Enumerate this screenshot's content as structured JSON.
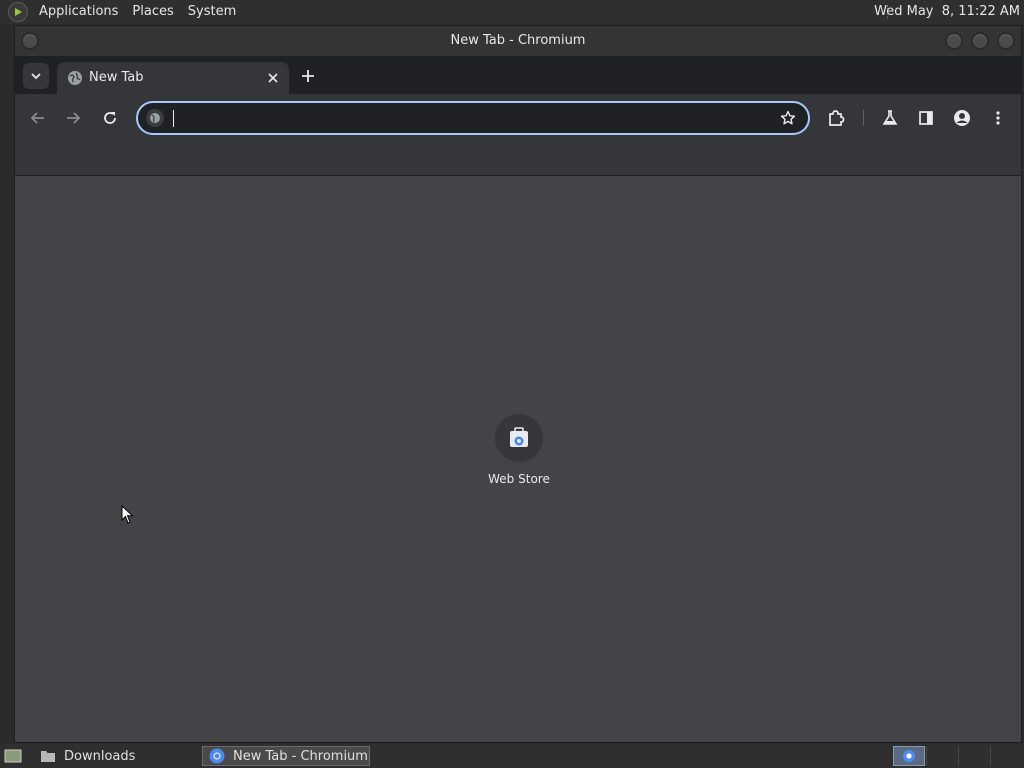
{
  "top_panel": {
    "menus": [
      "Applications",
      "Places",
      "System"
    ],
    "clock": "Wed May  8, 11:22 AM"
  },
  "window": {
    "title": "New Tab - Chromium"
  },
  "tabs": [
    {
      "title": "New Tab",
      "icon": "globe-icon",
      "active": true
    }
  ],
  "omnibox": {
    "value": "",
    "placeholder": ""
  },
  "content": {
    "shortcuts": [
      {
        "label": "Web Store",
        "icon": "web-store-icon"
      }
    ]
  },
  "taskbar": {
    "items": [
      {
        "label": "Downloads",
        "icon": "folder-icon"
      },
      {
        "label": "New Tab - Chromium",
        "icon": "chromium-icon",
        "active": true
      }
    ]
  },
  "colors": {
    "accent": "#a8c7fa",
    "content_bg": "#434348",
    "toolbar_bg": "#35363a",
    "tabstrip_bg": "#202124"
  }
}
